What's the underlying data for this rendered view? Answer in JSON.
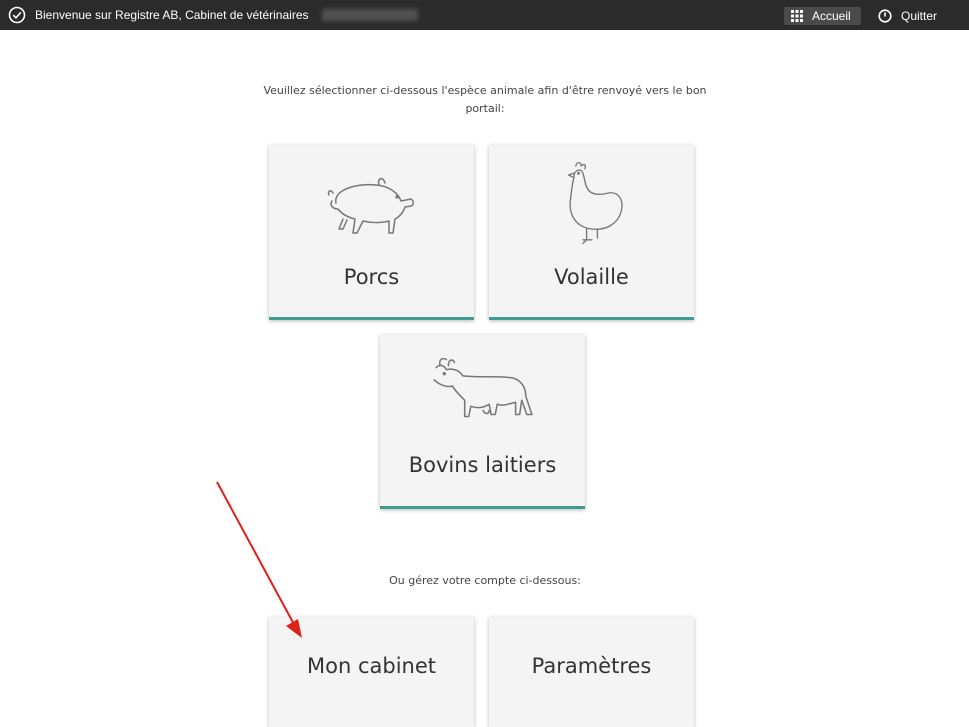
{
  "topbar": {
    "welcome_text": "Bienvenue sur Registre AB, Cabinet de vétérinaires",
    "accueil_label": "Accueil",
    "quitter_label": "Quitter"
  },
  "intro_text": "Veuillez sélectionner ci-dessous l'espèce animale afin d'être renvoyé vers le bon portail:",
  "species": [
    {
      "label": "Porcs",
      "icon": "pig-icon"
    },
    {
      "label": "Volaille",
      "icon": "chicken-icon"
    },
    {
      "label": "Bovins laitiers",
      "icon": "cow-icon"
    }
  ],
  "account_text": "Ou gérez votre compte ci-dessous:",
  "account": [
    {
      "label": "Mon cabinet"
    },
    {
      "label": "Paramètres"
    }
  ],
  "colors": {
    "topbar": "#2b2b2b",
    "tile_bg": "#f4f4f4",
    "accent_bar": "#3f9c8f",
    "annotation_arrow": "#e0201b"
  }
}
